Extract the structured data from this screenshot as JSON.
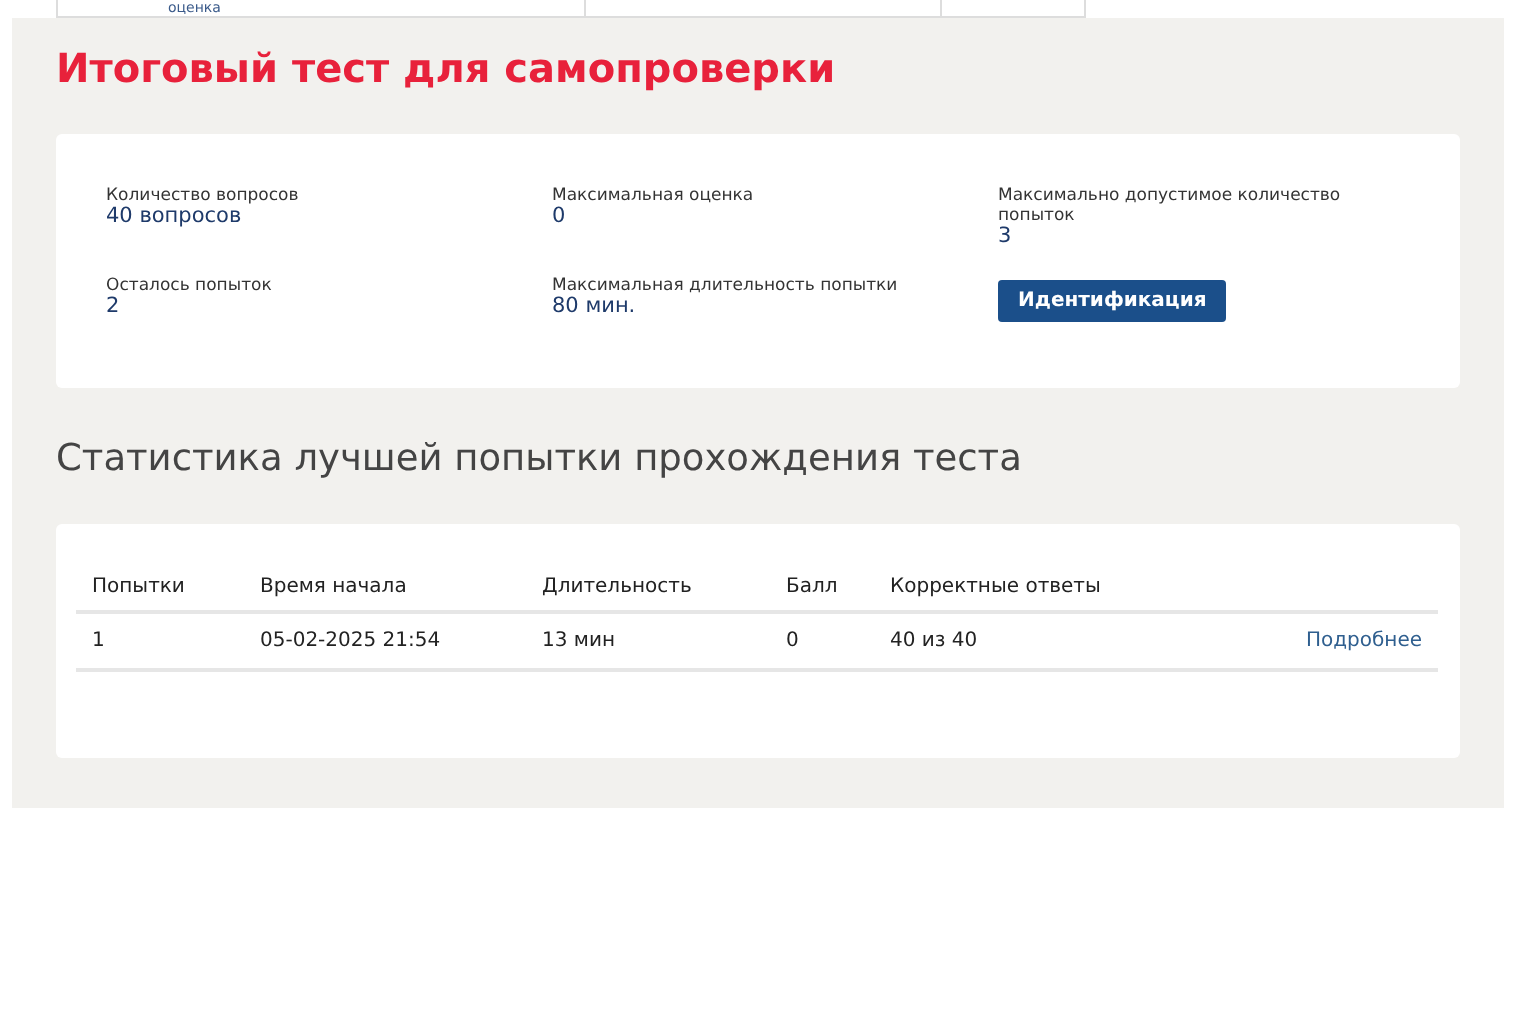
{
  "top_strip": {
    "cell_text": "оценка"
  },
  "title": "Итоговый тест для самопроверки",
  "info": [
    {
      "label": "Количество вопросов",
      "value": "40 вопросов"
    },
    {
      "label": "Максимальная оценка",
      "value": "0"
    },
    {
      "label": "Максимально допустимое количество попыток",
      "value": "3"
    },
    {
      "label": "Осталось попыток",
      "value": "2"
    },
    {
      "label": "Максимальная длительность попытки",
      "value": "80 мин."
    }
  ],
  "identify_button": "Идентификация",
  "stats_title": "Статистика лучшей попытки прохождения теста",
  "table": {
    "columns": [
      "Попытки",
      "Время начала",
      "Длительность",
      "Балл",
      "Корректные ответы"
    ],
    "rows": [
      {
        "cells": [
          "1",
          "05-02-2025 21:54",
          "13 мин",
          "0",
          "40 из 40"
        ],
        "link": "Подробнее"
      }
    ]
  }
}
